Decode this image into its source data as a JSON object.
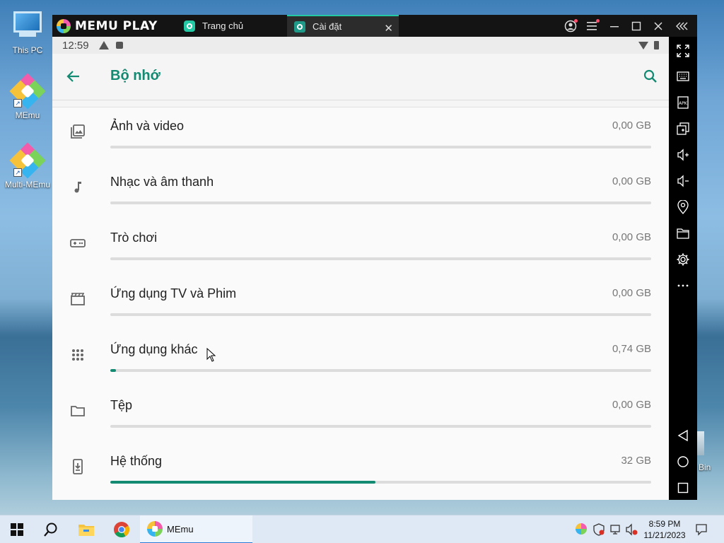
{
  "desktop": {
    "icons": [
      {
        "label": "This PC"
      },
      {
        "label": "MEmu"
      },
      {
        "label": "Multi-MEmu"
      }
    ],
    "recycle_fragment": "Bin"
  },
  "emulator": {
    "brand": "MEMU PLAY",
    "tabs": [
      {
        "label": "Trang chủ"
      },
      {
        "label": "Cài đặt"
      }
    ],
    "tab_close_icon": "close-icon",
    "window_controls": [
      "account-icon",
      "menu-icon",
      "minimize-icon",
      "maximize-icon",
      "close-icon",
      "collapse-icon"
    ]
  },
  "android": {
    "status_time": "12:59",
    "page_title": "Bộ nhớ",
    "accent": "#138a72",
    "storage_rows": [
      {
        "icon": "photo-icon",
        "label": "Ảnh và video",
        "size": "0,00 GB",
        "usage": 0.0
      },
      {
        "icon": "music-note-icon",
        "label": "Nhạc và âm thanh",
        "size": "0,00 GB",
        "usage": 0.0
      },
      {
        "icon": "gamepad-icon",
        "label": "Trò chơi",
        "size": "0,00 GB",
        "usage": 0.0
      },
      {
        "icon": "movie-icon",
        "label": "Ứng dụng TV và Phim",
        "size": "0,00 GB",
        "usage": 0.0
      },
      {
        "icon": "apps-grid-icon",
        "label": "Ứng dụng khác",
        "size": "0,74 GB",
        "usage": 0.01
      },
      {
        "icon": "folder-icon",
        "label": "Tệp",
        "size": "0,00 GB",
        "usage": 0.0
      },
      {
        "icon": "system-update-icon",
        "label": "Hệ thống",
        "size": "32 GB",
        "usage": 0.49
      }
    ]
  },
  "sidebar_tools": [
    "fullscreen-icon",
    "keyboard-icon",
    "apk-icon",
    "multi-window-icon",
    "volume-up-icon",
    "volume-down-icon",
    "location-icon",
    "folder-icon",
    "settings-icon",
    "more-icon",
    "android-back-icon",
    "android-home-icon",
    "android-recents-icon"
  ],
  "taskbar": {
    "memu_label": "MEmu",
    "clock_time": "8:59 PM",
    "clock_date": "11/21/2023"
  }
}
